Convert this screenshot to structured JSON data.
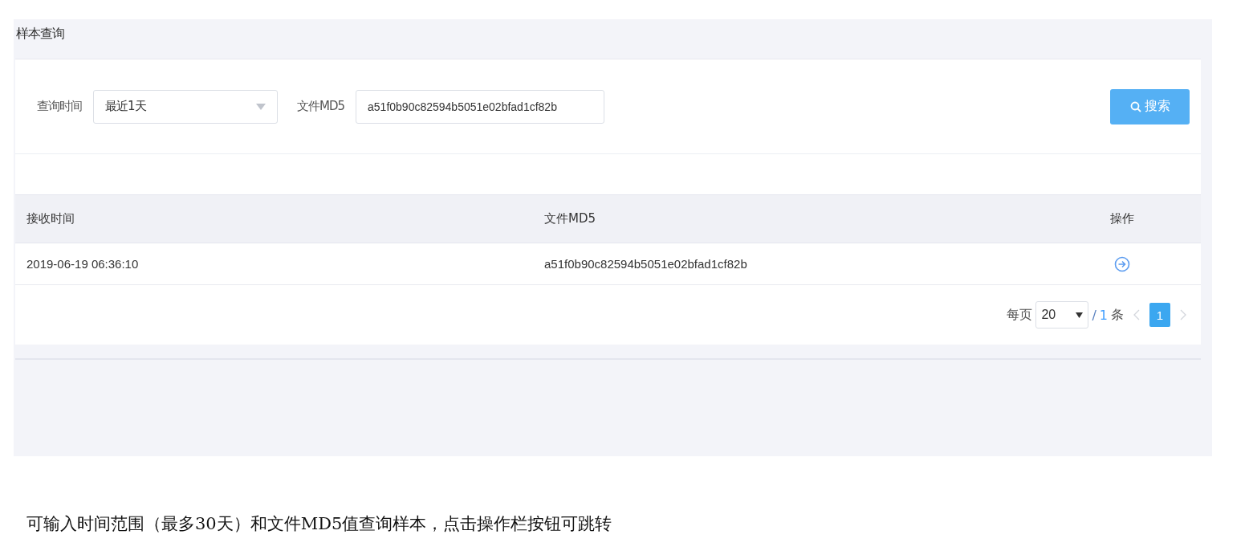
{
  "panel": {
    "title": "样本查询"
  },
  "filters": {
    "time_label": "查询时间",
    "time_value": "最近1天",
    "md5_label": "文件MD5",
    "md5_value": "a51f0b90c82594b5051e02bfad1cf82b",
    "search_button": "搜索"
  },
  "table": {
    "columns": [
      "接收时间",
      "文件MD5",
      "操作"
    ],
    "rows": [
      {
        "received": "2019-06-19 06:36:10",
        "md5": "a51f0b90c82594b5051e02bfad1cf82b"
      }
    ]
  },
  "pagination": {
    "per_page_label": "每页",
    "per_page_value": "20",
    "slash": "/",
    "total": "1",
    "unit": "条",
    "prev_disabled": true,
    "next_disabled": true,
    "pages": [
      {
        "label": "1",
        "selected": true
      }
    ]
  },
  "caption": "可输入时间范围（最多30天）和文件MD5值查询样本，点击操作栏按钮可跳转"
}
